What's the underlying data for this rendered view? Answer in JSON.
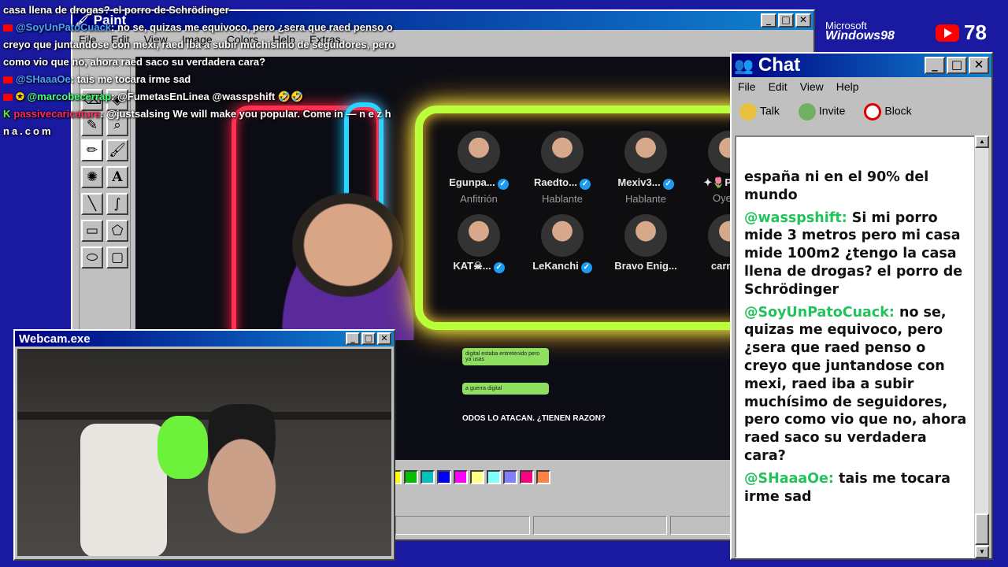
{
  "paint": {
    "title": "Paint",
    "menu": [
      "File",
      "Edit",
      "View",
      "Image",
      "Colors",
      "Help",
      "Extras"
    ],
    "stage_users": [
      {
        "name": "Egunpa...",
        "verified": true,
        "role": "Anfitrión"
      },
      {
        "name": "Raedto...",
        "verified": true,
        "role": "Hablante"
      },
      {
        "name": "Mexiv3...",
        "verified": true,
        "role": "Hablante"
      },
      {
        "name": "✦🌷Pink...",
        "verified": false,
        "role": "Oyente"
      },
      {
        "name": "KAT☠...",
        "verified": true,
        "role": ""
      },
      {
        "name": "LeKanchi",
        "verified": true,
        "role": ""
      },
      {
        "name": "Bravo Enig...",
        "verified": false,
        "role": ""
      },
      {
        "name": "carmen",
        "verified": false,
        "role": ""
      }
    ],
    "bubble1": "digital estaba entretenido pero ya usas",
    "bubble2": "a guerra digital",
    "headline": "ODOS LO ATACAN. ¿TIENEN RAZON?",
    "palette": [
      "#ffff00",
      "#00c000",
      "#00c0c0",
      "#0000ff",
      "#ff00ff",
      "#ffff80",
      "#80ffff",
      "#8080ff",
      "#ff0080",
      "#ff8040"
    ]
  },
  "overlay": {
    "line0": "casa llena de drogas? el porro de Schrödinger",
    "msg1_user": "@SoyUnPatoCuack",
    "msg1_text": ": no se, quizas me equivoco, pero ¿sera que raed penso o",
    "msg1_cont1": "creyo que juntandose con mexi, raed iba a subir muchisimo de seguidores, pero",
    "msg1_cont2": "como vio que no, ahora raed saco su verdadera cara?",
    "msg2_user": "@SHaaaOe",
    "msg2_text": ": tais me tocara irme sad",
    "msg3_user": "@marcobecerrap",
    "msg3_text": ": @FumetasEnLinea @wasspshift 🤣🤣",
    "msg4_user": "passivecaricature",
    "msg4_text": ": @justsalsing We will make you popular. Come in — n e z h",
    "msg4_cont": "na.com"
  },
  "branding": {
    "ms_top": "Microsoft",
    "ms_bottom": "Windows98",
    "viewers": "78"
  },
  "webcam": {
    "title": "Webcam.exe"
  },
  "chat": {
    "title": "Chat",
    "menu": [
      "File",
      "Edit",
      "View",
      "Help"
    ],
    "toolbar": {
      "talk": "Talk",
      "invite": "Invite",
      "block": "Block"
    },
    "messages": [
      {
        "user": "",
        "text": "españa ni en el 90% del mundo"
      },
      {
        "user": "@wasspshift:",
        "text": "Si mi porro mide 3 metros pero mi casa mide 100m2 ¿tengo la casa llena de drogas? el porro de Schrödinger"
      },
      {
        "user": "@SoyUnPatoCuack:",
        "text": "no se, quizas me equivoco, pero ¿sera que raed penso o creyo que juntandose con mexi, raed iba a subir muchísimo de seguidores, pero como vio que no, ahora raed saco su verdadera cara?"
      },
      {
        "user": "@SHaaaOe:",
        "text": "tais me tocara irme sad"
      }
    ]
  }
}
